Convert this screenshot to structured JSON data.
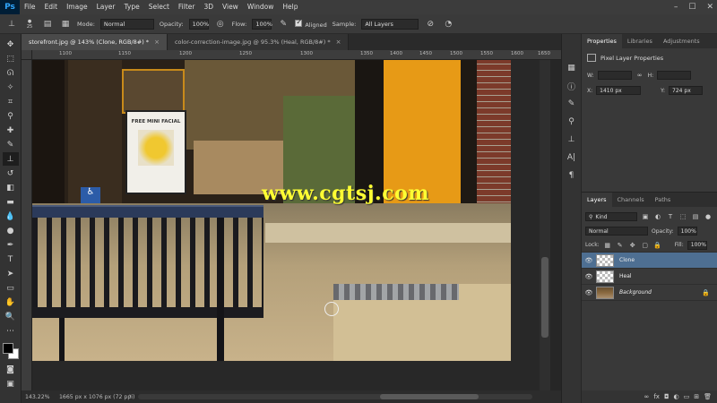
{
  "app": {
    "logo": "Ps",
    "menu": [
      "File",
      "Edit",
      "Image",
      "Layer",
      "Type",
      "Select",
      "Filter",
      "3D",
      "View",
      "Window",
      "Help"
    ],
    "window_controls": [
      "–",
      "☐",
      "✕"
    ]
  },
  "options_bar": {
    "brush_size": "25",
    "mode_label": "Mode:",
    "mode_value": "Normal",
    "opacity_label": "Opacity:",
    "opacity_value": "100%",
    "flow_label": "Flow:",
    "flow_value": "100%",
    "aligned_label": "Aligned",
    "sample_label": "Sample:",
    "sample_value": "All Layers"
  },
  "tabs": [
    {
      "label": "storefront.jpg @ 143% (Clone, RGB/8#) *",
      "close": "×",
      "active": true
    },
    {
      "label": "color-correction-image.jpg @ 95.3% (Heal, RGB/8#) *",
      "close": "×",
      "active": false
    }
  ],
  "ruler": {
    "marks": [
      "1100",
      "1150",
      "1200",
      "1250",
      "1300",
      "1350",
      "1400",
      "1450",
      "1500",
      "1550",
      "1600",
      "1650"
    ]
  },
  "canvas": {
    "watermark": "www.cgtsj.com",
    "poster_text": "FREE MINI FACIAL"
  },
  "status": {
    "zoom": "143.22%",
    "doc_info": "1665 px x 1076 px (72 ppi)"
  },
  "properties_panel": {
    "tabs": [
      "Properties",
      "Libraries",
      "Adjustments"
    ],
    "title": "Pixel Layer Properties",
    "w_label": "W:",
    "h_label": "H:",
    "x_label": "X:",
    "x_value": "1410 px",
    "y_label": "Y:",
    "y_value": "724 px"
  },
  "layers_panel": {
    "tabs": [
      "Layers",
      "Channels",
      "Paths"
    ],
    "kind_label": "Kind",
    "blend_mode": "Normal",
    "opacity_label": "Opacity:",
    "opacity_value": "100%",
    "lock_label": "Lock:",
    "fill_label": "Fill:",
    "fill_value": "100%",
    "layers": [
      {
        "name": "Clone",
        "active": true
      },
      {
        "name": "Heal",
        "active": false
      },
      {
        "name": "Background",
        "active": false
      }
    ]
  }
}
